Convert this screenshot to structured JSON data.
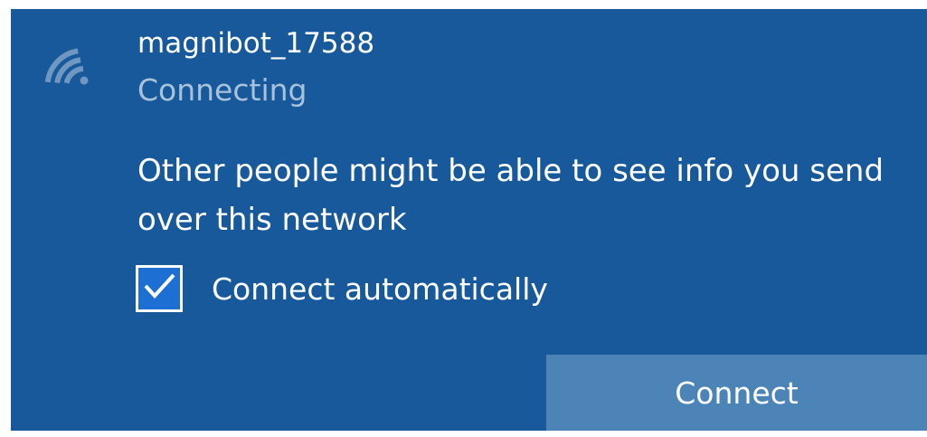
{
  "network": {
    "name": "magnibot_17588",
    "status": "Connecting",
    "icon": "wifi-icon"
  },
  "warning": {
    "text": "Other people might be able to see info you send over this network"
  },
  "auto_connect": {
    "label": "Connect automatically",
    "checked": true,
    "icon": "checkmark-icon"
  },
  "actions": {
    "connect_label": "Connect"
  },
  "colors": {
    "panel_background": "#17599a",
    "status_text": "#a8c2dc",
    "checkbox_fill": "#1d6fd4",
    "button_background": "#4c84b7",
    "text": "#ffffff"
  }
}
